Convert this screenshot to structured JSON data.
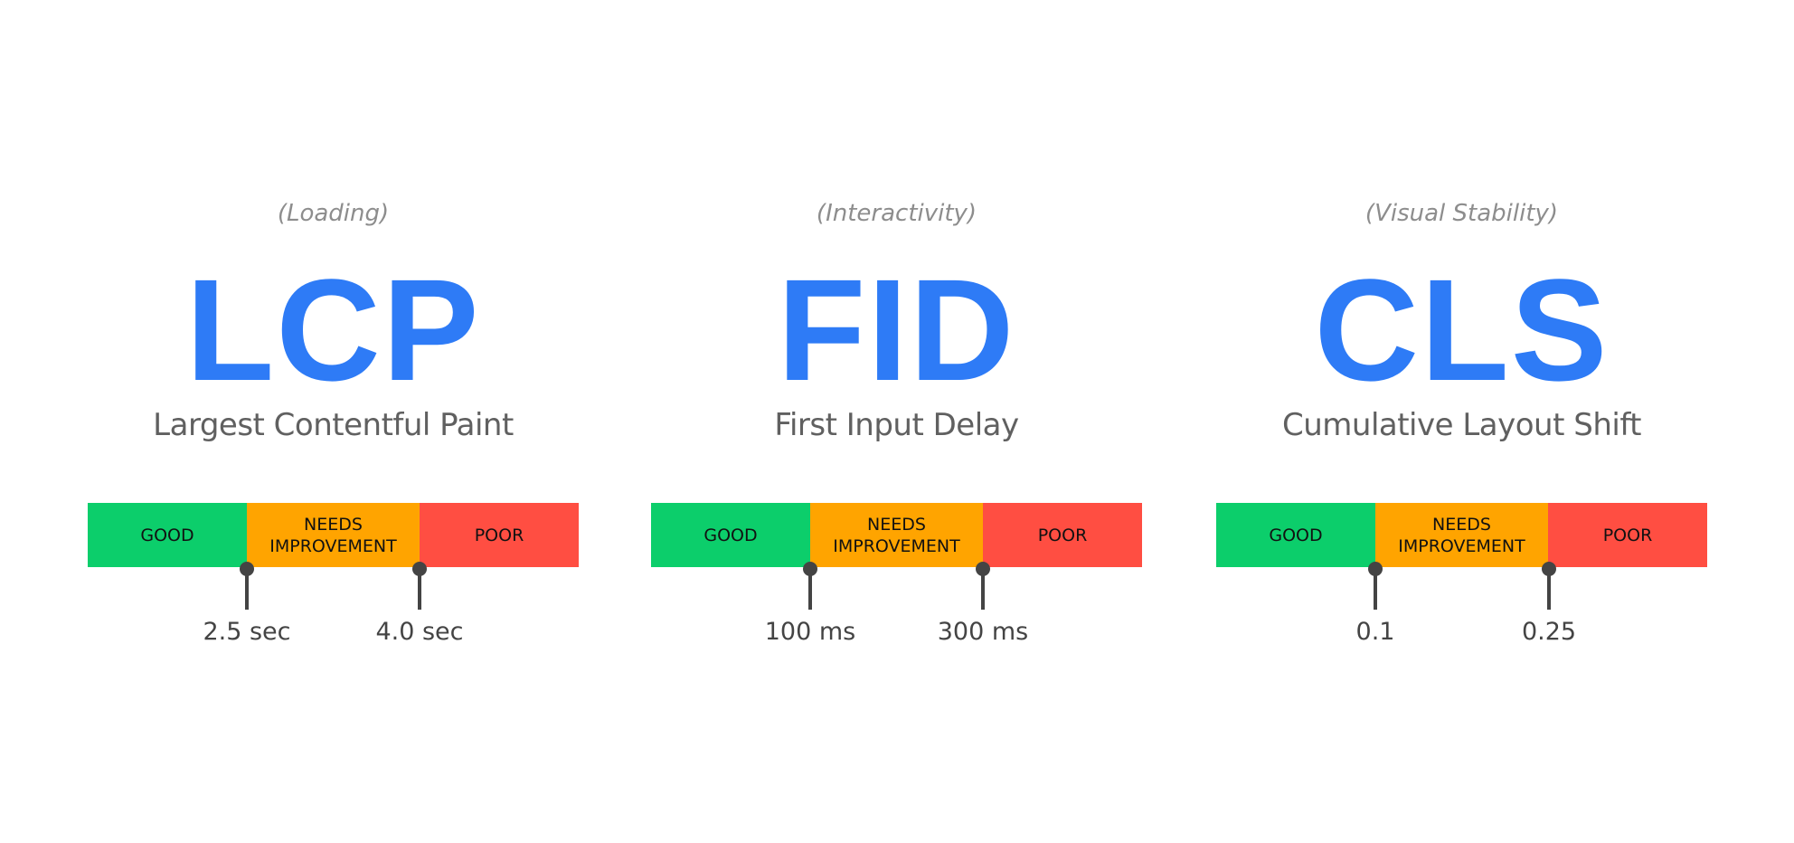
{
  "colors": {
    "acronym": "#2e7bf6",
    "category": "#8d8d8d",
    "fullname": "#606060",
    "good": "#0cce6b",
    "needs_improvement": "#ffa400",
    "poor": "#ff4e42",
    "band_text": "#111111",
    "marker": "#444444"
  },
  "metrics": [
    {
      "id": "lcp",
      "category": "(Loading)",
      "acronym": "LCP",
      "full_name": "Largest Contentful Paint",
      "bands": {
        "good": "GOOD",
        "needs_line1": "NEEDS",
        "needs_line2": "IMPROVEMENT",
        "poor": "POOR"
      },
      "thresholds": [
        {
          "value": 2.5,
          "unit": "sec",
          "label": "2.5 sec"
        },
        {
          "value": 4.0,
          "unit": "sec",
          "label": "4.0 sec"
        }
      ]
    },
    {
      "id": "fid",
      "category": "(Interactivity)",
      "acronym": "FID",
      "full_name": "First Input Delay",
      "bands": {
        "good": "GOOD",
        "needs_line1": "NEEDS",
        "needs_line2": "IMPROVEMENT",
        "poor": "POOR"
      },
      "thresholds": [
        {
          "value": 100,
          "unit": "ms",
          "label": "100 ms"
        },
        {
          "value": 300,
          "unit": "ms",
          "label": "300 ms"
        }
      ]
    },
    {
      "id": "cls",
      "category": "(Visual Stability)",
      "acronym": "CLS",
      "full_name": "Cumulative Layout Shift",
      "bands": {
        "good": "GOOD",
        "needs_line1": "NEEDS",
        "needs_line2": "IMPROVEMENT",
        "poor": "POOR"
      },
      "thresholds": [
        {
          "value": 0.1,
          "unit": "",
          "label": "0.1"
        },
        {
          "value": 0.25,
          "unit": "",
          "label": "0.25"
        }
      ]
    }
  ]
}
